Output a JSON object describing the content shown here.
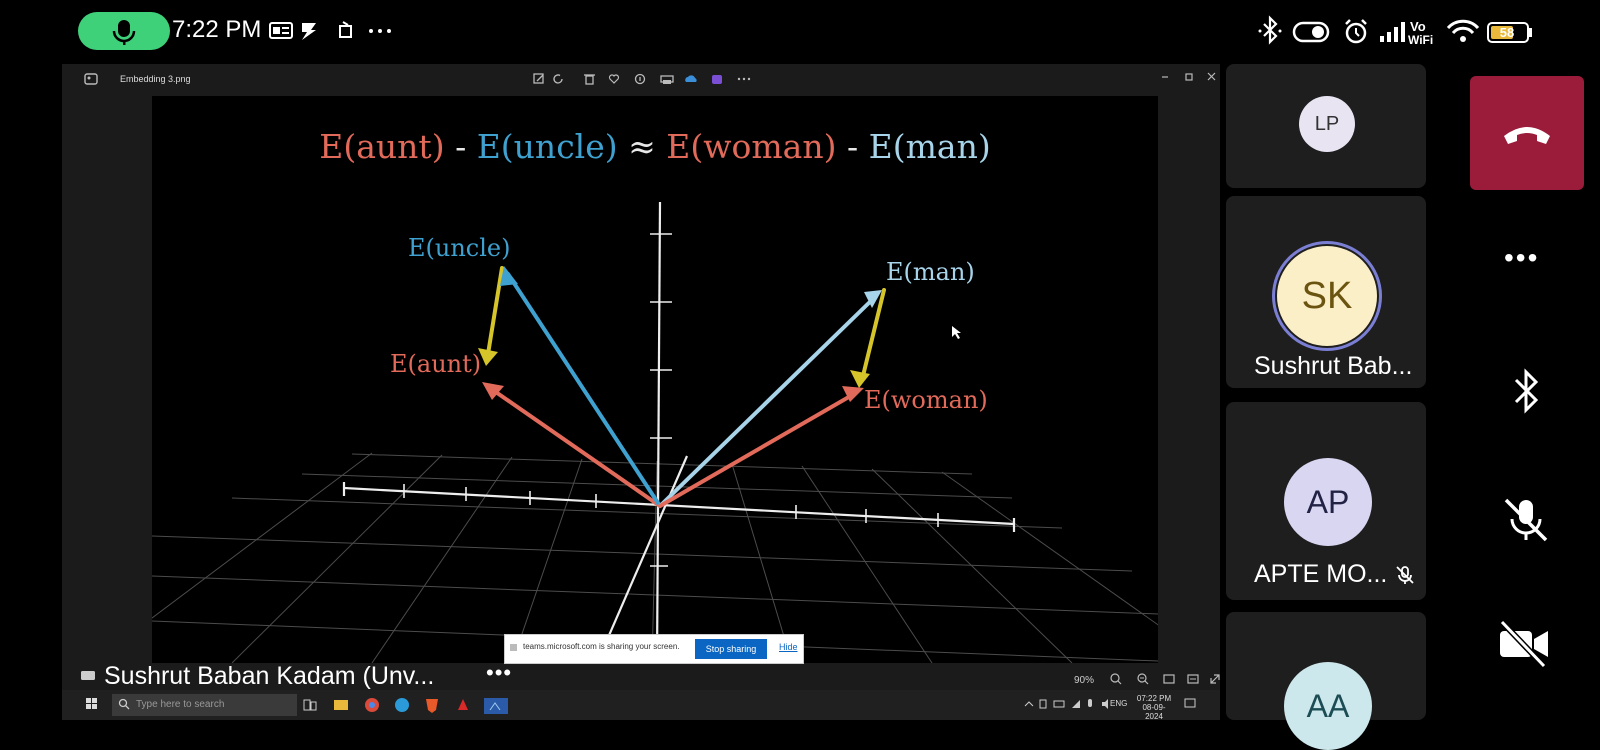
{
  "status_bar": {
    "time": "7:22 PM",
    "battery": "58",
    "network_label_top": "Vo",
    "network_label_bottom": "WiFi",
    "icons": [
      "mic-icon",
      "gallery-icon",
      "app-icon",
      "notification-icon",
      "more-icon",
      "bluetooth-icon",
      "data-saver-icon",
      "alarm-icon",
      "signal-icon",
      "wifi-icon",
      "battery-icon"
    ]
  },
  "window": {
    "title": "Embedding 3.png",
    "toolbar_icons": [
      "edit-icon",
      "rotate-icon",
      "delete-icon",
      "favorite-icon",
      "info-icon",
      "print-icon",
      "onedrive-icon",
      "clipchamp-icon",
      "more-icon"
    ],
    "window_controls": [
      "minimize-icon",
      "restore-icon",
      "close-icon"
    ]
  },
  "figure": {
    "title_parts": [
      "E(aunt)",
      "-",
      "E(uncle)",
      "≈",
      "E(woman)",
      "-",
      "E(man)"
    ],
    "labels": {
      "uncle": "E(uncle)",
      "aunt": "E(aunt)",
      "man": "E(man)",
      "woman": "E(woman)"
    },
    "colors": {
      "red": "#e26a5a",
      "blue": "#3fa1d0",
      "light_blue": "#a8d4ea",
      "yellow": "#d5c52a",
      "operator": "#e8e8e8"
    }
  },
  "share_banner": {
    "text": "teams.microsoft.com is sharing your screen.",
    "stop_label": "Stop sharing",
    "hide_label": "Hide"
  },
  "presenter_name": "Sushrut Baban Kadam (Unv...",
  "more_label": "•••",
  "viewer": {
    "zoom": "90%"
  },
  "taskbar": {
    "search_placeholder": "Type here to search",
    "language": "ENG",
    "time": "07:22 PM",
    "date": "08-09-2024"
  },
  "participants": [
    {
      "initials": "LP",
      "name": "",
      "avatar_bg": "#e8e4f2",
      "avatar_fg": "#333333"
    },
    {
      "initials": "SK",
      "name": "Sushrut Bab...",
      "avatar_bg": "#fbefc8",
      "avatar_fg": "#6b5410"
    },
    {
      "initials": "AP",
      "name": "APTE MO...",
      "avatar_bg": "#d9d6f2",
      "avatar_fg": "#222244",
      "muted": true
    },
    {
      "initials": "AA",
      "name": "",
      "avatar_bg": "#cde8ec",
      "avatar_fg": "#1c4d55"
    }
  ],
  "controls": [
    "end-call-icon",
    "more-options-icon",
    "bluetooth-icon",
    "mic-off-icon",
    "camera-off-icon"
  ],
  "controls_more_label": "•••"
}
